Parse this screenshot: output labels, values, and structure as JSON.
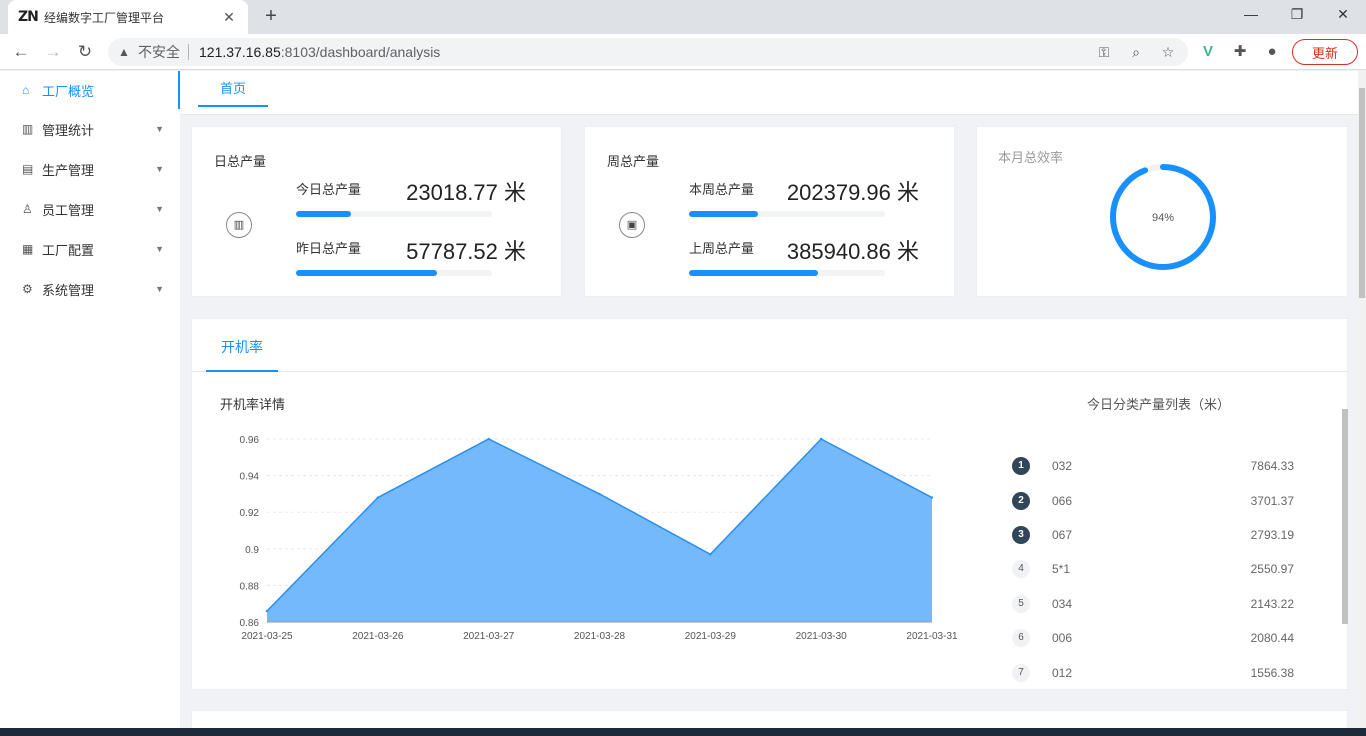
{
  "browser": {
    "tab_logo": "ZN",
    "tab_title": "经编数字工厂管理平台",
    "insecure_label": "不安全",
    "url_host": "121.37.16.85",
    "url_path": ":8103/dashboard/analysis",
    "update_label": "更新"
  },
  "sidebar": {
    "items": [
      {
        "label": "工厂概览",
        "icon": "home-icon"
      },
      {
        "label": "管理统计",
        "icon": "bar-chart-icon"
      },
      {
        "label": "生产管理",
        "icon": "document-icon"
      },
      {
        "label": "员工管理",
        "icon": "user-icon"
      },
      {
        "label": "工厂配置",
        "icon": "config-icon"
      },
      {
        "label": "系统管理",
        "icon": "gear-icon"
      }
    ]
  },
  "content_tabs": [
    {
      "label": "首页"
    }
  ],
  "daily": {
    "title": "日总产量",
    "today_label": "今日总产量",
    "today_value": "23018.77 米",
    "today_fraction": 0.28,
    "yesterday_label": "昨日总产量",
    "yesterday_value": "57787.52 米",
    "yesterday_fraction": 0.72
  },
  "weekly": {
    "title": "周总产量",
    "this_label": "本周总产量",
    "this_value": "202379.96 米",
    "this_fraction": 0.35,
    "last_label": "上周总产量",
    "last_value": "385940.86 米",
    "last_fraction": 0.66
  },
  "efficiency": {
    "title": "本月总效率",
    "value_label": "94%",
    "percent": 94
  },
  "chart_section": {
    "tab": "开机率",
    "chart_title": "开机率详情",
    "rank_title": "今日分类产量列表（米）"
  },
  "chart_data": {
    "type": "area",
    "x": [
      "2021-03-25",
      "2021-03-26",
      "2021-03-27",
      "2021-03-28",
      "2021-03-29",
      "2021-03-30",
      "2021-03-31"
    ],
    "values": [
      0.866,
      0.928,
      0.96,
      0.93,
      0.897,
      0.96,
      0.928
    ],
    "ylim": [
      0.86,
      0.96
    ],
    "yticks": [
      "0.86",
      "0.88",
      "0.9",
      "0.92",
      "0.94",
      "0.96"
    ],
    "grid": true,
    "fill_color": "#74b9fb",
    "line_color": "#2b8fef"
  },
  "rank_list": [
    {
      "rank": "1",
      "name": "032",
      "value": "7864.33"
    },
    {
      "rank": "2",
      "name": "066",
      "value": "3701.37"
    },
    {
      "rank": "3",
      "name": "067",
      "value": "2793.19"
    },
    {
      "rank": "4",
      "name": "5*1",
      "value": "2550.97"
    },
    {
      "rank": "5",
      "name": "034",
      "value": "2143.22"
    },
    {
      "rank": "6",
      "name": "006",
      "value": "2080.44"
    },
    {
      "rank": "7",
      "name": "012",
      "value": "1556.38"
    }
  ],
  "colors": {
    "accent": "#1890ff",
    "rank_top": "#314659"
  }
}
